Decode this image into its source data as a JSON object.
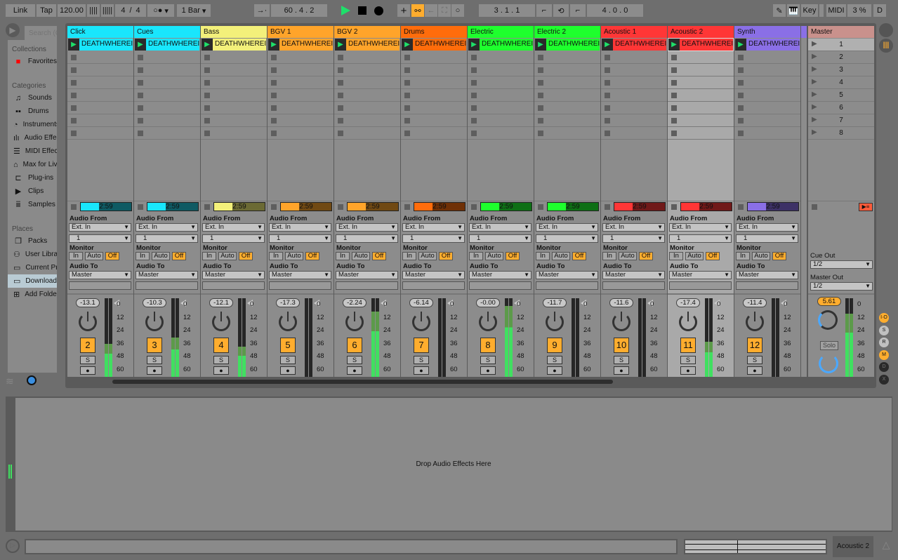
{
  "transport": {
    "link": "Link",
    "tap": "Tap",
    "tempo": "120.00",
    "sig_num": "4",
    "sig_den": "4",
    "sig_sep": "/",
    "metro": "○●",
    "quant": "1 Bar",
    "position": "60 .  4 .  2",
    "loop_start": "3 .  1 .  1",
    "loop_len": "4 .  0 .  0",
    "key": "Key",
    "midi": "MIDI",
    "cpu": "3 %",
    "d": "D"
  },
  "browser": {
    "search_placeholder": "Search (Cmd+F)",
    "collections_label": "Collections",
    "collections": [
      {
        "label": "Favorites",
        "icon": "red-square"
      }
    ],
    "categories_label": "Categories",
    "categories": [
      {
        "label": "Sounds",
        "icon": "music-note-icon"
      },
      {
        "label": "Drums",
        "icon": "grid-icon"
      },
      {
        "label": "Instruments",
        "icon": "knob-icon"
      },
      {
        "label": "Audio Effects",
        "icon": "waveform-icon"
      },
      {
        "label": "MIDI Effects",
        "icon": "midi-lines-icon"
      },
      {
        "label": "Max for Live",
        "icon": "max-icon"
      },
      {
        "label": "Plug-ins",
        "icon": "plug-icon"
      },
      {
        "label": "Clips",
        "icon": "clip-icon"
      },
      {
        "label": "Samples",
        "icon": "sample-icon"
      }
    ],
    "places_label": "Places",
    "places": [
      {
        "label": "Packs",
        "icon": "packs-icon"
      },
      {
        "label": "User Library",
        "icon": "user-icon"
      },
      {
        "label": "Current Project",
        "icon": "folder-icon"
      },
      {
        "label": "Downloads",
        "icon": "folder-icon",
        "selected": true
      },
      {
        "label": "Add Folder...",
        "icon": "add-folder-icon"
      }
    ]
  },
  "io": {
    "audio_from": "Audio From",
    "ext_in": "Ext. In",
    "channel": "1",
    "monitor": "Monitor",
    "in": "In",
    "auto": "Auto",
    "off": "Off",
    "audio_to": "Audio To",
    "master": "Master"
  },
  "clip_name": "DEATHWHEREISYOURSTING",
  "clip_time": "2:59",
  "solo_label": "S",
  "tracks": [
    {
      "name": "Click",
      "color": "#19e6fc",
      "dark": "#0f5a63",
      "num": "2",
      "vol": "-13.1",
      "meter": 0.42
    },
    {
      "name": "Cues",
      "color": "#19e6fc",
      "dark": "#0f5a63",
      "num": "3",
      "vol": "-10.3",
      "meter": 0.5
    },
    {
      "name": "Bass",
      "color": "#f3f07a",
      "dark": "#6b6a34",
      "num": "4",
      "vol": "-12.1",
      "meter": 0.38
    },
    {
      "name": "BGV 1",
      "color": "#ffa42a",
      "dark": "#704913",
      "num": "5",
      "vol": "-17.3",
      "meter": 0
    },
    {
      "name": "BGV 2",
      "color": "#ffa42a",
      "dark": "#704913",
      "num": "6",
      "vol": "-2.24",
      "meter": 0.83
    },
    {
      "name": "Drums",
      "color": "#ff6c0b",
      "dark": "#6f3006",
      "num": "7",
      "vol": "-6.14",
      "meter": 0
    },
    {
      "name": "Electric",
      "color": "#1eff2d",
      "dark": "#0e6f15",
      "num": "8",
      "vol": "-0.00",
      "meter": 0.9
    },
    {
      "name": "Electric 2",
      "color": "#1eff2d",
      "dark": "#0e6f15",
      "num": "9",
      "vol": "-11.7",
      "meter": 0
    },
    {
      "name": "Acoustic 1",
      "color": "#ff3636",
      "dark": "#701919",
      "num": "10",
      "vol": "-11.6",
      "meter": 0
    },
    {
      "name": "Acoustic 2",
      "color": "#ff3636",
      "dark": "#701919",
      "num": "11",
      "vol": "-17.4",
      "meter": 0.45,
      "selected": true
    },
    {
      "name": "Synth",
      "color": "#8a6fe6",
      "dark": "#3d3166",
      "num": "12",
      "vol": "-11.4",
      "meter": 0
    }
  ],
  "master": {
    "name": "Master",
    "color": "#c9918c",
    "scenes": [
      "1",
      "2",
      "3",
      "4",
      "5",
      "6",
      "7",
      "8"
    ],
    "cue_out_label": "Cue Out",
    "cue_out": "1/2",
    "master_out_label": "Master Out",
    "master_out": "1/2",
    "vol": "5.61",
    "solo": "Solo",
    "meter": 0.8
  },
  "meter_scale": [
    "0",
    "12",
    "24",
    "36",
    "48",
    "60"
  ],
  "side_buttons": [
    "I·O",
    "S",
    "R",
    "M",
    "D",
    "X"
  ],
  "detail": {
    "drop_text": "Drop Audio Effects Here"
  },
  "status": {
    "selected_track": "Acoustic 2"
  }
}
